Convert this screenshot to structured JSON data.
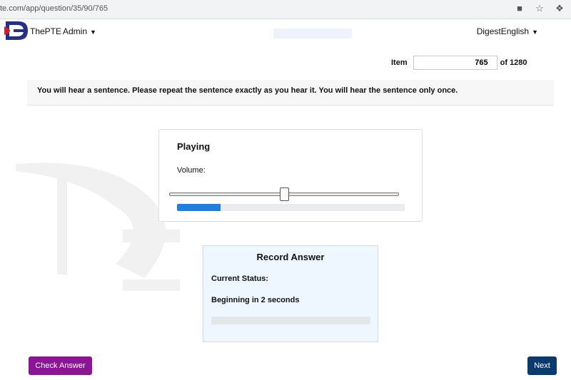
{
  "browser": {
    "url": "te.com/app/question/35/90/765"
  },
  "navbar": {
    "brand": "ThePTE",
    "user_menu": "Admin",
    "account_menu": "DigestEnglish"
  },
  "item": {
    "label": "Item",
    "value": "765",
    "total_label": "of 1280"
  },
  "instruction": "You will hear a sentence. Please repeat the sentence exactly as you hear it. You will hear the sentence only once.",
  "audio_player": {
    "title": "Playing",
    "volume_label": "Volume:",
    "volume_level": 0.5,
    "progress": 0.19
  },
  "record_panel": {
    "title": "Record Answer",
    "status_label": "Current Status:",
    "status_value": "Beginning in 2 seconds"
  },
  "buttons": {
    "check_answer": "Check Answer",
    "next": "Next"
  },
  "colors": {
    "check_button": "#8b1595",
    "next_button": "#0b3b6e",
    "progress_fill": "#1e7fe0",
    "logo_red": "#d0202a",
    "logo_navy": "#23318a"
  },
  "icons": [
    "camera-icon",
    "star-icon",
    "extension-icon",
    "caret-down-icon"
  ]
}
